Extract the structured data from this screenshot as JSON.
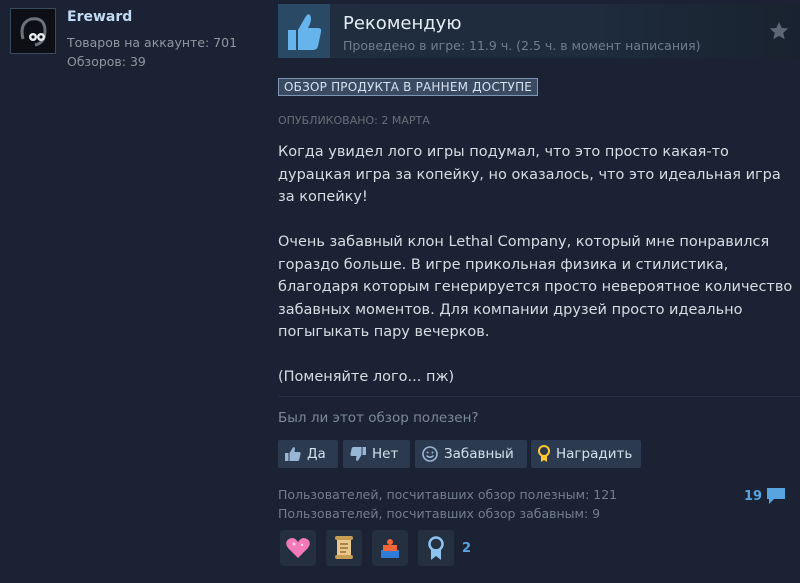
{
  "author": {
    "username": "Ereward",
    "products_label": "Товаров на аккаунте: 701",
    "reviews_label": "Обзоров: 39"
  },
  "review": {
    "verdict": "Рекомендую",
    "hours": "Проведено в игре: 11.9 ч. (2.5 ч. в момент написания)",
    "badge": "ОБЗОР ПРОДУКТА В РАННЕМ ДОСТУПЕ",
    "posted": "ОПУБЛИКОВАНО: 2 МАРТА",
    "paragraphs": [
      "Когда увидел лого игры подумал, что это просто какая-то дурацкая игра за копейку, но оказалось, что это идеальная игра за копейку!",
      "Очень забавный клон Lethal Company, который мне понравился гораздо больше. В игре прикольная физика и стилистика, благодаря которым генерируется просто невероятное количество забавных моментов. Для компании друзей просто идеально погыгыкать пару вечерков.",
      "(Поменяйте лого... пж)"
    ]
  },
  "feedback": {
    "question": "Был ли этот обзор полезен?",
    "yes": "Да",
    "no": "Нет",
    "funny": "Забавный",
    "award": "Наградить",
    "helpful_count_text": "Пользователей, посчитавших обзор полезным: 121",
    "funny_count_text": "Пользователей, посчитавших обзор забавным: 9",
    "comments_count": "19"
  },
  "awards": {
    "items": [
      "heart-award-icon",
      "scroll-award-icon",
      "gift-award-icon",
      "ribbon-award-icon"
    ],
    "last_count": "2"
  }
}
